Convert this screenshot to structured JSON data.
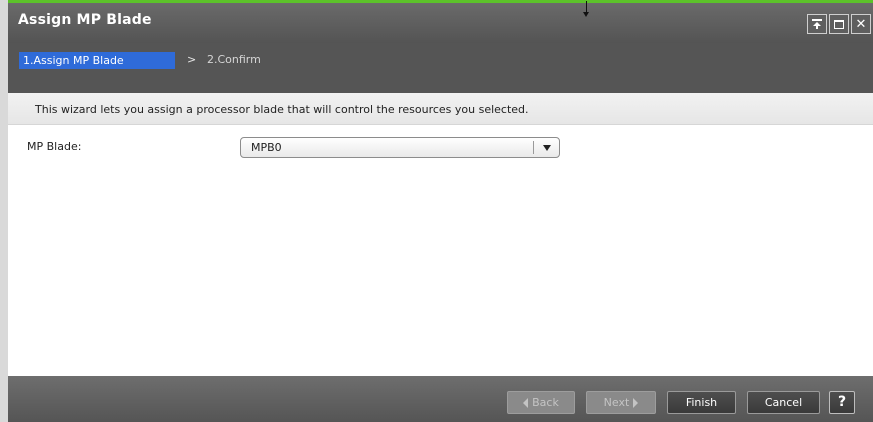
{
  "window": {
    "title": "Assign MP Blade",
    "controls": [
      "pin-icon",
      "maximize-icon",
      "close-icon"
    ],
    "close_glyph": "✕"
  },
  "steps": {
    "active": "1.Assign MP Blade",
    "separator": ">",
    "next": "2.Confirm"
  },
  "description": "This wizard lets you assign a processor blade that will control the resources you selected.",
  "form": {
    "mp_blade_label": "MP Blade:",
    "mp_blade_value": "MPB0"
  },
  "footer": {
    "back_label": "Back",
    "next_label": "Next",
    "finish_label": "Finish",
    "cancel_label": "Cancel",
    "help_label": "?"
  },
  "colors": {
    "accent_green": "#5cc22a",
    "active_step_blue": "#2f6bd9",
    "titlebar": "#5e5e5e"
  }
}
